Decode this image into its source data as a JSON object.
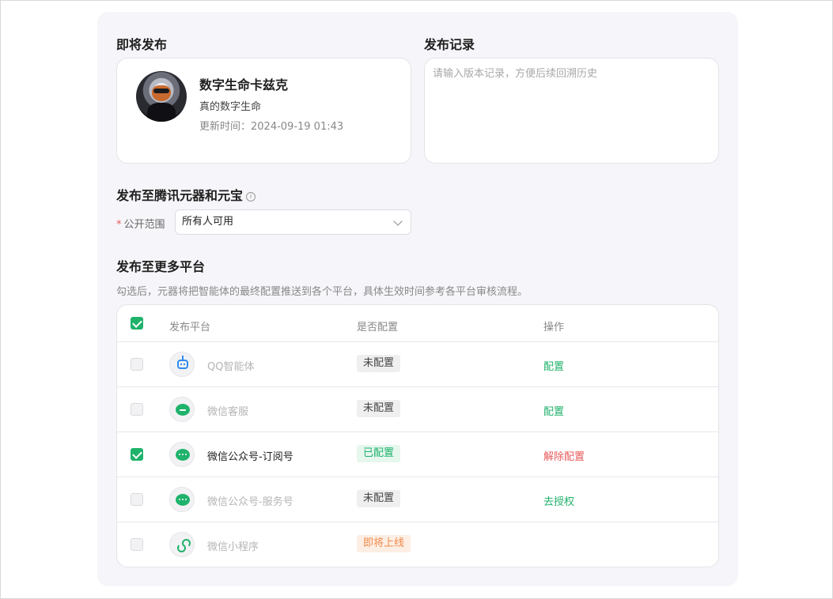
{
  "upcoming": {
    "title": "即将发布",
    "bot_name": "数字生命卡兹克",
    "bot_desc": "真的数字生命",
    "update_time": "更新时间：2024-09-19 01:43"
  },
  "record": {
    "title": "发布记录",
    "placeholder": "请输入版本记录，方便后续回溯历史"
  },
  "tencent": {
    "title": "发布至腾讯元器和元宝",
    "info_icon": "i",
    "required_mark": "*",
    "scope_label": "公开范围",
    "scope_value": "所有人可用"
  },
  "more": {
    "title": "发布至更多平台",
    "hint": "勾选后，元器将把智能体的最终配置推送到各个平台，具体生效时间参考各平台审核流程。",
    "columns": [
      "发布平台",
      "是否配置",
      "操作"
    ],
    "header_checked": true,
    "rows": [
      {
        "name": "QQ智能体",
        "icon": "qq-robot-icon",
        "status": "未配置",
        "status_style": "gray",
        "action": "配置",
        "action_style": "green",
        "checked": false,
        "active": false
      },
      {
        "name": "微信客服",
        "icon": "wechat-kf-icon",
        "status": "未配置",
        "status_style": "gray",
        "action": "配置",
        "action_style": "green",
        "checked": false,
        "active": false
      },
      {
        "name": "微信公众号-订阅号",
        "icon": "wechat-icon",
        "status": "已配置",
        "status_style": "green",
        "action": "解除配置",
        "action_style": "red",
        "checked": true,
        "active": true
      },
      {
        "name": "微信公众号-服务号",
        "icon": "wechat-icon",
        "status": "未配置",
        "status_style": "gray",
        "action": "去授权",
        "action_style": "green",
        "checked": false,
        "active": false
      },
      {
        "name": "微信小程序",
        "icon": "mini-program-icon",
        "status": "即将上线",
        "status_style": "orange",
        "action": "",
        "action_style": "green",
        "checked": false,
        "active": false
      }
    ]
  },
  "colors": {
    "accent_green": "#1fb26b",
    "danger_red": "#e85a5a",
    "warn_orange": "#f08a4b",
    "panel_bg": "#f6f6fa"
  }
}
